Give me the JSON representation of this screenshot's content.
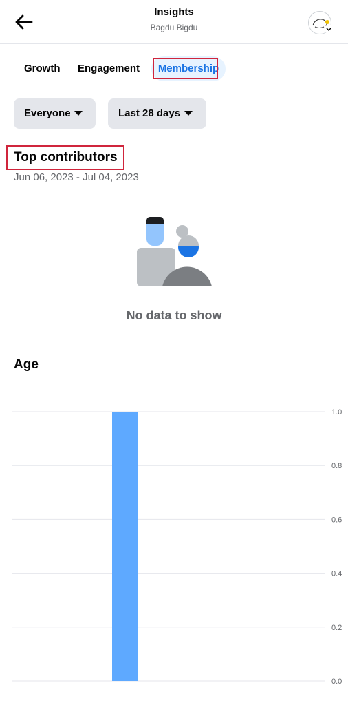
{
  "header": {
    "title": "Insights",
    "subtitle": "Bagdu Bigdu",
    "back_icon": "arrow-left-icon",
    "avatar_icon": "profile-avatar"
  },
  "tabs": [
    {
      "label": "Growth",
      "selected": false
    },
    {
      "label": "Engagement",
      "selected": false
    },
    {
      "label": "Membership",
      "selected": true
    }
  ],
  "filters": {
    "audience": "Everyone",
    "range": "Last 28 days"
  },
  "top_contributors": {
    "title": "Top contributors",
    "date_range": "Jun 06, 2023 - Jul 04, 2023",
    "empty_message": "No data to show"
  },
  "age": {
    "title": "Age"
  },
  "colors": {
    "accent": "#1b74e4",
    "tab_selected_bg": "#e7f3ff",
    "bar": "#5ea9ff",
    "highlight_box": "#d0253c",
    "muted_text": "#65676b"
  },
  "chart_data": {
    "type": "bar",
    "categories": [
      ""
    ],
    "values": [
      1.0
    ],
    "ylim": [
      0,
      1.0
    ],
    "yticks": [
      "1.0",
      "0.8",
      "0.6",
      "0.4",
      "0.2",
      "0.0"
    ],
    "ytick_values": [
      1.0,
      0.8,
      0.6,
      0.4,
      0.2,
      0.0
    ],
    "grid": true,
    "yaxis_side": "right"
  }
}
